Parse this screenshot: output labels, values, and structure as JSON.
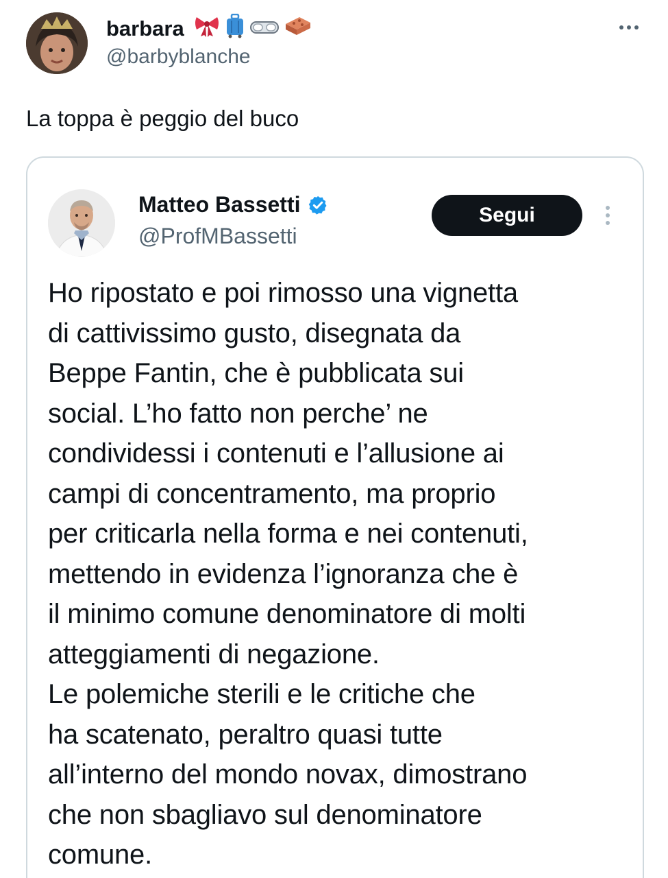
{
  "tweet": {
    "author": {
      "name": "barbara",
      "handle": "@barbyblanche",
      "emojis": [
        "bow-emoji",
        "luggage-emoji",
        "goggles-emoji",
        "brick-emoji"
      ]
    },
    "text": "La toppa è peggio del buco",
    "more_label": "More"
  },
  "quoted": {
    "author": {
      "name": "Matteo Bassetti",
      "handle": "@ProfMBassetti",
      "verified": true
    },
    "follow_label": "Segui",
    "lines": [
      "Ho ripostato e poi rimosso una vignetta",
      "di cattivissimo gusto, disegnata da",
      "Beppe Fantin, che è pubblicata sui",
      "social. L’ho fatto non perche’ ne",
      "condividessi i contenuti e l’allusione ai",
      "campi di concentramento, ma proprio",
      "per criticarla nella forma e nei contenuti,",
      "mettendo in evidenza l’ignoranza che è",
      "il minimo comune denominatore di molti",
      "atteggiamenti di negazione.",
      "Le polemiche sterili e le critiche che",
      "ha scatenato, peraltro quasi tutte",
      "all’interno del mondo novax, dimostrano",
      "che non sbagliavo sul denominatore",
      "comune."
    ]
  },
  "colors": {
    "text": "#0f1419",
    "secondary": "#536471",
    "border": "#cfd9de",
    "verified": "#1d9bf0",
    "button_bg": "#0f1419"
  }
}
